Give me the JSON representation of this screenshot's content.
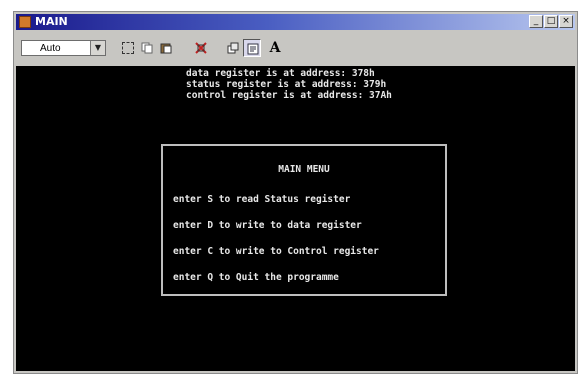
{
  "window": {
    "title": "MAIN"
  },
  "window_buttons": {
    "minimize": "_",
    "maximize": "□",
    "close": "×"
  },
  "toolbar": {
    "font_select": {
      "value": "Auto"
    },
    "icons": [
      "mark-icon",
      "copy-icon",
      "paste-icon",
      "fullscreen-icon",
      "properties-icon",
      "background-icon",
      "font-icon"
    ],
    "font_glyph": "A"
  },
  "terminal": {
    "lines": [
      "data register is at address: 378h",
      "status register is at address: 379h",
      "control register is at address: 37Ah"
    ],
    "menu": {
      "title": "MAIN MENU",
      "items": [
        "enter S to read Status register",
        "enter D to write to data register",
        "enter C to write to Control register",
        "enter Q to Quit the programme"
      ]
    }
  },
  "colors": {
    "titlebar_start": "#1a1a8c",
    "terminal_bg": "#000000",
    "terminal_text": "#e8e8e8",
    "chrome": "#c7c6c2"
  }
}
